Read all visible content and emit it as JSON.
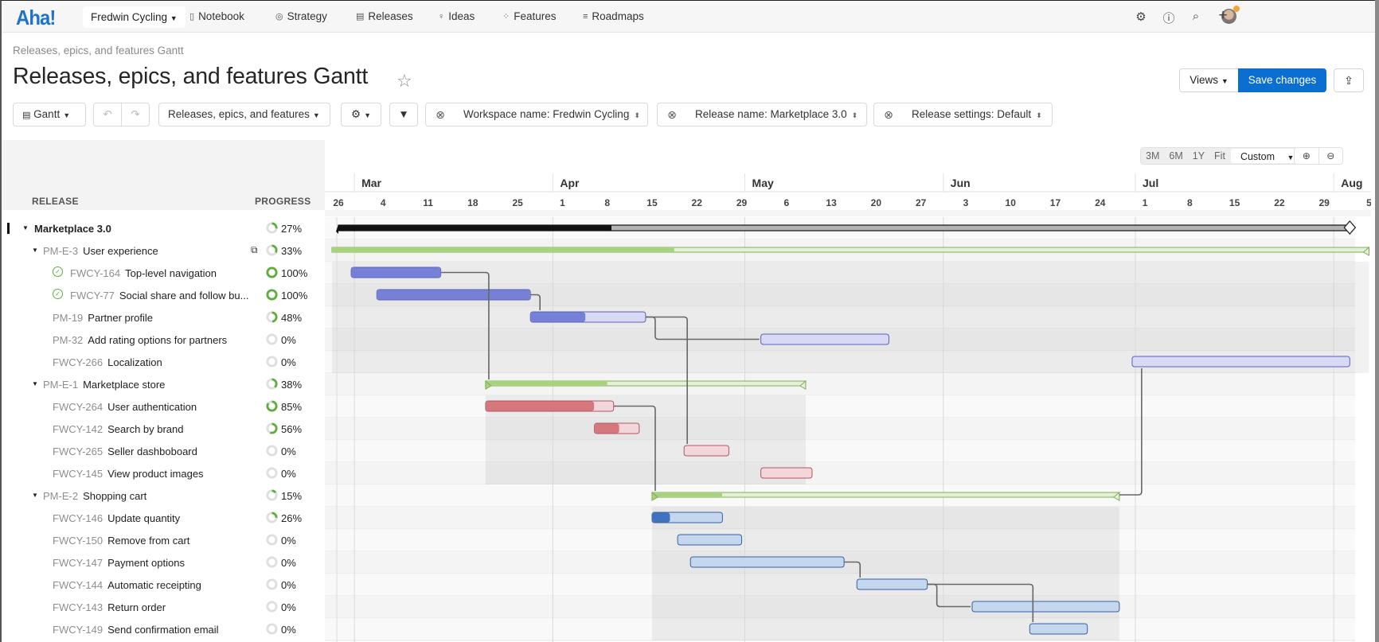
{
  "nav": {
    "logo": "Aha!",
    "workspace": "Fredwin Cycling",
    "items": [
      {
        "label": "Notebook",
        "icon": "notebook-icon",
        "glyph": "▯"
      },
      {
        "label": "Strategy",
        "icon": "target-icon",
        "glyph": "◎"
      },
      {
        "label": "Releases",
        "icon": "calendar-icon",
        "glyph": "▤"
      },
      {
        "label": "Ideas",
        "icon": "lightbulb-icon",
        "glyph": "♡"
      },
      {
        "label": "Features",
        "icon": "grid-icon",
        "glyph": "⁘"
      },
      {
        "label": "Roadmaps",
        "icon": "roadmap-icon",
        "glyph": "≡"
      }
    ],
    "right_icons": [
      "avatar",
      "settings-icon",
      "help-icon",
      "search-icon",
      "add-icon"
    ]
  },
  "header": {
    "breadcrumb": "Releases, epics, and features Gantt",
    "title": "Releases, epics, and features Gantt",
    "views_label": "Views",
    "save_label": "Save changes"
  },
  "toolbar": {
    "view_type": "Gantt",
    "report_type": "Releases, epics, and features",
    "filters": [
      {
        "label": "Workspace name: Fredwin Cycling"
      },
      {
        "label": "Release name: Marketplace 3.0"
      },
      {
        "label": "Release settings: Default"
      }
    ]
  },
  "timescale": {
    "options": [
      "3M",
      "6M",
      "1Y",
      "Fit"
    ],
    "selected": "Custom"
  },
  "columns": {
    "release": "RELEASE",
    "progress": "PROGRESS"
  },
  "colors": {
    "release_bar": "#111111",
    "epic_bar": "#a8d27d",
    "feature_ux": "#7680d6",
    "feature_store": "#d6767d",
    "feature_cart": "#3f73c0",
    "save_button": "#0b6fd1",
    "progress_ring": "#5cad3c"
  },
  "chart_data": {
    "type": "gantt",
    "start_date": "2024-02-26",
    "months": [
      {
        "label": "Mar",
        "date": "2024-03-01"
      },
      {
        "label": "Apr",
        "date": "2024-04-01"
      },
      {
        "label": "May",
        "date": "2024-05-01"
      },
      {
        "label": "Jun",
        "date": "2024-06-01"
      },
      {
        "label": "Jul",
        "date": "2024-07-01"
      },
      {
        "label": "Aug",
        "date": "2024-08-01"
      }
    ],
    "week_ticks": [
      "26",
      "4",
      "11",
      "18",
      "25",
      "1",
      "8",
      "15",
      "22",
      "29",
      "6",
      "13",
      "20",
      "27",
      "3",
      "10",
      "17",
      "24",
      "1",
      "8",
      "15",
      "22",
      "29",
      "5"
    ],
    "rows": [
      {
        "level": 0,
        "kind": "release",
        "key": "",
        "name": "Marketplace 3.0",
        "progress": 27,
        "start": 0,
        "end": 158,
        "milestone": true
      },
      {
        "level": 1,
        "kind": "epic",
        "key": "PM-E-3",
        "name": "User experience",
        "progress": 33,
        "start": -1,
        "end": 161,
        "external": true
      },
      {
        "level": 2,
        "kind": "feature",
        "group": "ux",
        "key": "FWCY-164",
        "name": "Top-level navigation",
        "progress": 100,
        "start": 2,
        "end": 16,
        "done": true
      },
      {
        "level": 2,
        "kind": "feature",
        "group": "ux",
        "key": "FWCY-77",
        "name": "Social share and follow bu...",
        "progress": 100,
        "start": 6,
        "end": 30,
        "done": true
      },
      {
        "level": 2,
        "kind": "feature",
        "group": "ux",
        "key": "PM-19",
        "name": "Partner profile",
        "progress": 48,
        "start": 30,
        "end": 48
      },
      {
        "level": 2,
        "kind": "feature",
        "group": "ux",
        "key": "PM-32",
        "name": "Add rating options for partners",
        "progress": 0,
        "start": 66,
        "end": 86
      },
      {
        "level": 2,
        "kind": "feature",
        "group": "ux",
        "key": "FWCY-266",
        "name": "Localization",
        "progress": 0,
        "start": 124,
        "end": 158
      },
      {
        "level": 1,
        "kind": "epic",
        "key": "PM-E-1",
        "name": "Marketplace store",
        "progress": 38,
        "start": 23,
        "end": 73
      },
      {
        "level": 2,
        "kind": "feature",
        "group": "store",
        "key": "FWCY-264",
        "name": "User authentication",
        "progress": 85,
        "start": 23,
        "end": 43
      },
      {
        "level": 2,
        "kind": "feature",
        "group": "store",
        "key": "FWCY-142",
        "name": "Search by brand",
        "progress": 56,
        "start": 40,
        "end": 47
      },
      {
        "level": 2,
        "kind": "feature",
        "group": "store",
        "key": "FWCY-265",
        "name": "Seller dashboboard",
        "progress": 0,
        "start": 54,
        "end": 61
      },
      {
        "level": 2,
        "kind": "feature",
        "group": "store",
        "key": "FWCY-145",
        "name": "View product images",
        "progress": 0,
        "start": 66,
        "end": 74
      },
      {
        "level": 1,
        "kind": "epic",
        "key": "PM-E-2",
        "name": "Shopping cart",
        "progress": 15,
        "start": 49,
        "end": 122
      },
      {
        "level": 2,
        "kind": "feature",
        "group": "cart",
        "key": "FWCY-146",
        "name": "Update quantity",
        "progress": 26,
        "start": 49,
        "end": 60
      },
      {
        "level": 2,
        "kind": "feature",
        "group": "cart",
        "key": "FWCY-150",
        "name": "Remove from cart",
        "progress": 0,
        "start": 53,
        "end": 63
      },
      {
        "level": 2,
        "kind": "feature",
        "group": "cart",
        "key": "FWCY-147",
        "name": "Payment options",
        "progress": 0,
        "start": 55,
        "end": 79
      },
      {
        "level": 2,
        "kind": "feature",
        "group": "cart",
        "key": "FWCY-144",
        "name": "Automatic receipting",
        "progress": 0,
        "start": 81,
        "end": 92
      },
      {
        "level": 2,
        "kind": "feature",
        "group": "cart",
        "key": "FWCY-143",
        "name": "Return order",
        "progress": 0,
        "start": 99,
        "end": 122
      },
      {
        "level": 2,
        "kind": "feature",
        "group": "cart",
        "key": "FWCY-149",
        "name": "Send confirmation email",
        "progress": 0,
        "start": 108,
        "end": 117
      }
    ],
    "dependencies": [
      {
        "from": 2,
        "to": 7
      },
      {
        "from": 3,
        "to": 4
      },
      {
        "from": 4,
        "to": 5
      },
      {
        "from": 4,
        "to": 10
      },
      {
        "from": 8,
        "to": 12
      },
      {
        "from": 12,
        "to": 6
      },
      {
        "from": 15,
        "to": 16
      },
      {
        "from": 16,
        "to": 17
      },
      {
        "from": 16,
        "to": 18
      }
    ]
  }
}
